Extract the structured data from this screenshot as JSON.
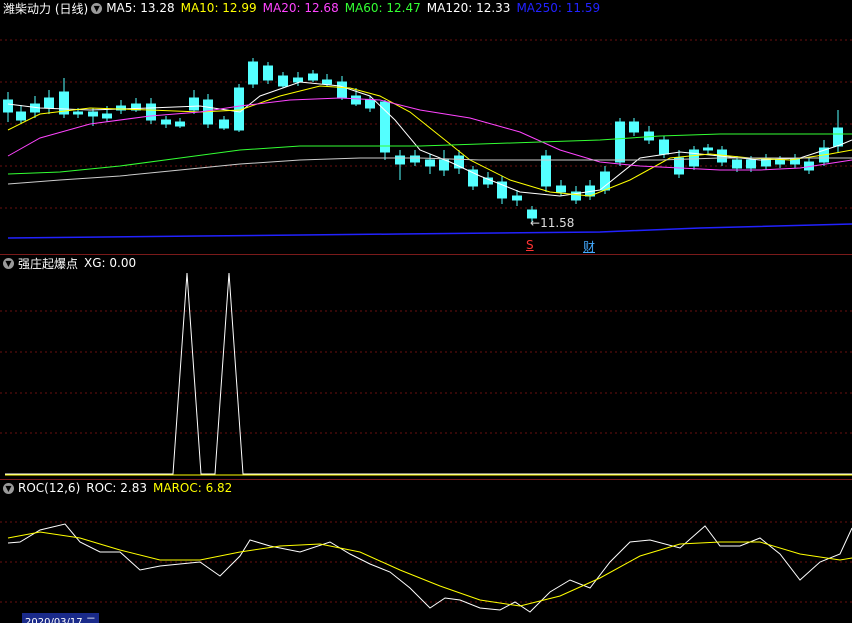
{
  "main": {
    "title": "潍柴动力 (日线)",
    "ma": [
      {
        "label": "MA5: 13.28",
        "color": "#ffffff"
      },
      {
        "label": "MA10: 12.99",
        "color": "#ffff00"
      },
      {
        "label": "MA20: 12.68",
        "color": "#ff44ff"
      },
      {
        "label": "MA60: 12.47",
        "color": "#33ff33"
      },
      {
        "label": "MA120: 12.33",
        "color": "#ffffff"
      },
      {
        "label": "MA250: 11.59",
        "color": "#2222ff"
      }
    ],
    "low_label": "11.58",
    "marker_s": "S",
    "marker_cai": "财"
  },
  "ind1": {
    "name": "强庄起爆点",
    "value": "XG: 0.00",
    "spikes": [
      0,
      0,
      0,
      0,
      0,
      0,
      0,
      0,
      0,
      0,
      0,
      0,
      0,
      1,
      0,
      0,
      1,
      0,
      0,
      0,
      0,
      0,
      0,
      0,
      0,
      0,
      0,
      0,
      0,
      0,
      0,
      0,
      0,
      0,
      0,
      0,
      0,
      0,
      0,
      0,
      0,
      0,
      0,
      0,
      0,
      0,
      0,
      0,
      0,
      0,
      0,
      0,
      0,
      0,
      0,
      0,
      0,
      0,
      0,
      0,
      0
    ]
  },
  "ind2": {
    "name": "ROC(12,6)",
    "roc_label": "ROC: 2.83",
    "maroc_label": "MAROC: 6.82",
    "roc_color": "#ffffff",
    "maroc_color": "#ffff00",
    "date_label": "2020/03/17 二"
  }
}
